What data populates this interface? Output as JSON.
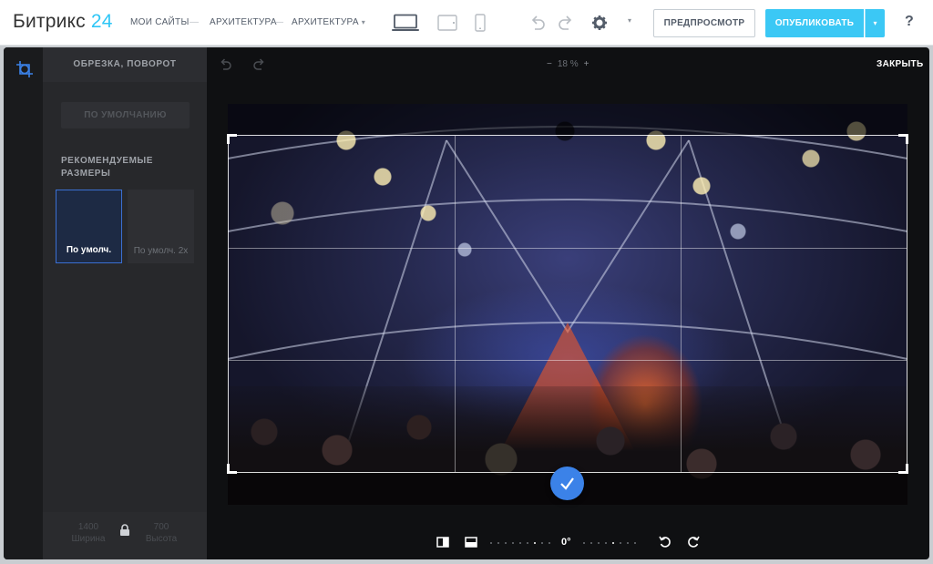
{
  "app": {
    "logo_text": "Битрикс",
    "logo_number": "24"
  },
  "topbar": {
    "nav": [
      {
        "label": "МОИ САЙТЫ"
      },
      {
        "label": "АРХИТЕКТУРА"
      },
      {
        "label": "АРХИТЕКТУРА"
      }
    ],
    "sep": "—",
    "caret": "▾",
    "preview_label": "ПРЕДПРОСМОТР",
    "publish_label": "ОПУБЛИКОВАТЬ",
    "publish_dropdown": "▾",
    "help_label": "?"
  },
  "editor": {
    "panel_title": "ОБРЕЗКА, ПОВОРОТ",
    "default_button": "ПО УМОЛЧАНИЮ",
    "recommended_title": "РЕКОМЕНДУЕМЫЕ РАЗМЕРЫ",
    "presets": [
      {
        "label": "По умолч.",
        "selected": true
      },
      {
        "label": "По умолч. 2x",
        "selected": false
      }
    ],
    "width_value": "1400",
    "width_label": "Ширина",
    "height_value": "700",
    "height_label": "Высота",
    "zoom": {
      "minus": "−",
      "value": "18 %",
      "plus": "+"
    },
    "close_label": "ЗАКРЫТЬ",
    "rotation_angle": "0°"
  },
  "colors": {
    "accent": "#3bc8f5",
    "apply_button": "#3b82e8",
    "preset_selected_border": "#3b6fd1"
  }
}
